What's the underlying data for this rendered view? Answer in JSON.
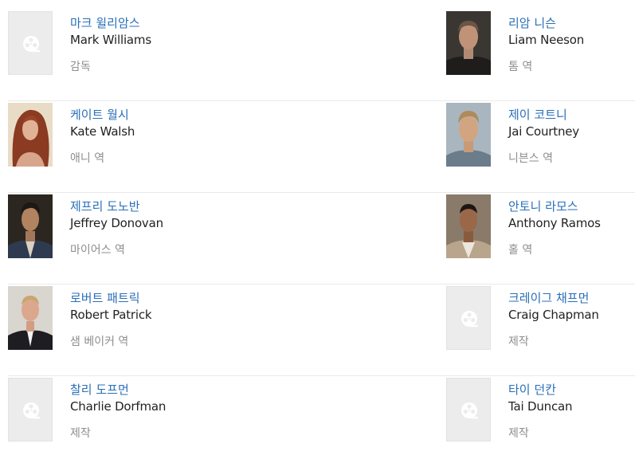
{
  "cast": [
    [
      {
        "name_ko": "마크 윌리암스",
        "name_en": "Mark Williams",
        "role": "감독",
        "photo": "placeholder-film-icon"
      },
      {
        "name_ko": "리암 니슨",
        "name_en": "Liam Neeson",
        "role": "톰 역",
        "photo": "portrait"
      }
    ],
    [
      {
        "name_ko": "케이트 월시",
        "name_en": "Kate Walsh",
        "role": "애니 역",
        "photo": "portrait"
      },
      {
        "name_ko": "제이 코트니",
        "name_en": "Jai Courtney",
        "role": "니븐스 역",
        "photo": "portrait"
      }
    ],
    [
      {
        "name_ko": "제프리 도노반",
        "name_en": "Jeffrey Donovan",
        "role": "마이어스 역",
        "photo": "portrait"
      },
      {
        "name_ko": "안토니 라모스",
        "name_en": "Anthony Ramos",
        "role": "홀 역",
        "photo": "portrait"
      }
    ],
    [
      {
        "name_ko": "로버트 패트릭",
        "name_en": "Robert Patrick",
        "role": "샘 베이커 역",
        "photo": "portrait"
      },
      {
        "name_ko": "크레이그 채프먼",
        "name_en": "Craig Chapman",
        "role": "제작",
        "photo": "placeholder-film-icon"
      }
    ],
    [
      {
        "name_ko": "찰리 도프먼",
        "name_en": "Charlie Dorfman",
        "role": "제작",
        "photo": "placeholder-film-icon"
      },
      {
        "name_ko": "타이 던칸",
        "name_en": "Tai Duncan",
        "role": "제작",
        "photo": "placeholder-film-icon"
      }
    ]
  ],
  "colors": {
    "name_link": "#2a6fb8",
    "name_en": "#222222",
    "role": "#8e8e8e",
    "divider": "#e9e9e9",
    "placeholder_bg": "#ececec"
  }
}
